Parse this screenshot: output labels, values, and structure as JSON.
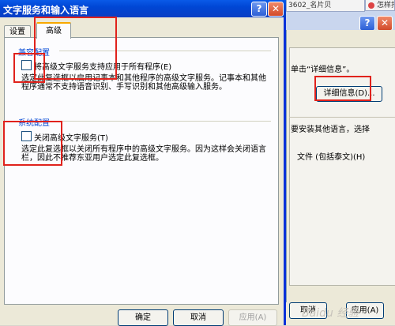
{
  "dialog": {
    "title": "文字服务和输入语言",
    "help_glyph": "?",
    "close_glyph": "✕",
    "tabs": [
      {
        "label": "设置",
        "active": false
      },
      {
        "label": "高级",
        "active": true
      }
    ],
    "compat_group": {
      "title": "兼容配置",
      "checkbox_label": "将高级文字服务支持应用于所有程序(E)",
      "checked": false,
      "description": "选定此复选框以启用记事本和其他程序的高级文字服务。记事本和其他程序通常不支持语音识别、手写识别和其他高级输入服务。"
    },
    "system_group": {
      "title": "系统配置",
      "checkbox_label": "关闭高级文字服务(T)",
      "checked": false,
      "description": "选定此复选框以关闭所有程序中的高级文字服务。因为这样会关闭语言栏，因此不推荐东亚用户选定此复选框。"
    },
    "buttons": {
      "ok": "确定",
      "cancel": "取消",
      "apply": "应用(A)"
    }
  },
  "background_window": {
    "tab1": "3602_名片贝",
    "tab2": "怎样打",
    "help_glyph": "?",
    "close_glyph": "✕",
    "text_details": "单击“详细信息”。",
    "details_button": "详细信息(D)...",
    "text_install": "要安装其他语言，选择",
    "text_files": "文件 (包括泰文)(H)",
    "cancel_button": "取消",
    "apply_button": "应用(A)"
  },
  "watermark": "Baidu 经验",
  "colors": {
    "titlebar": "#0a5ae8",
    "highlight": "#e0221c",
    "group_title": "#0046d5"
  }
}
